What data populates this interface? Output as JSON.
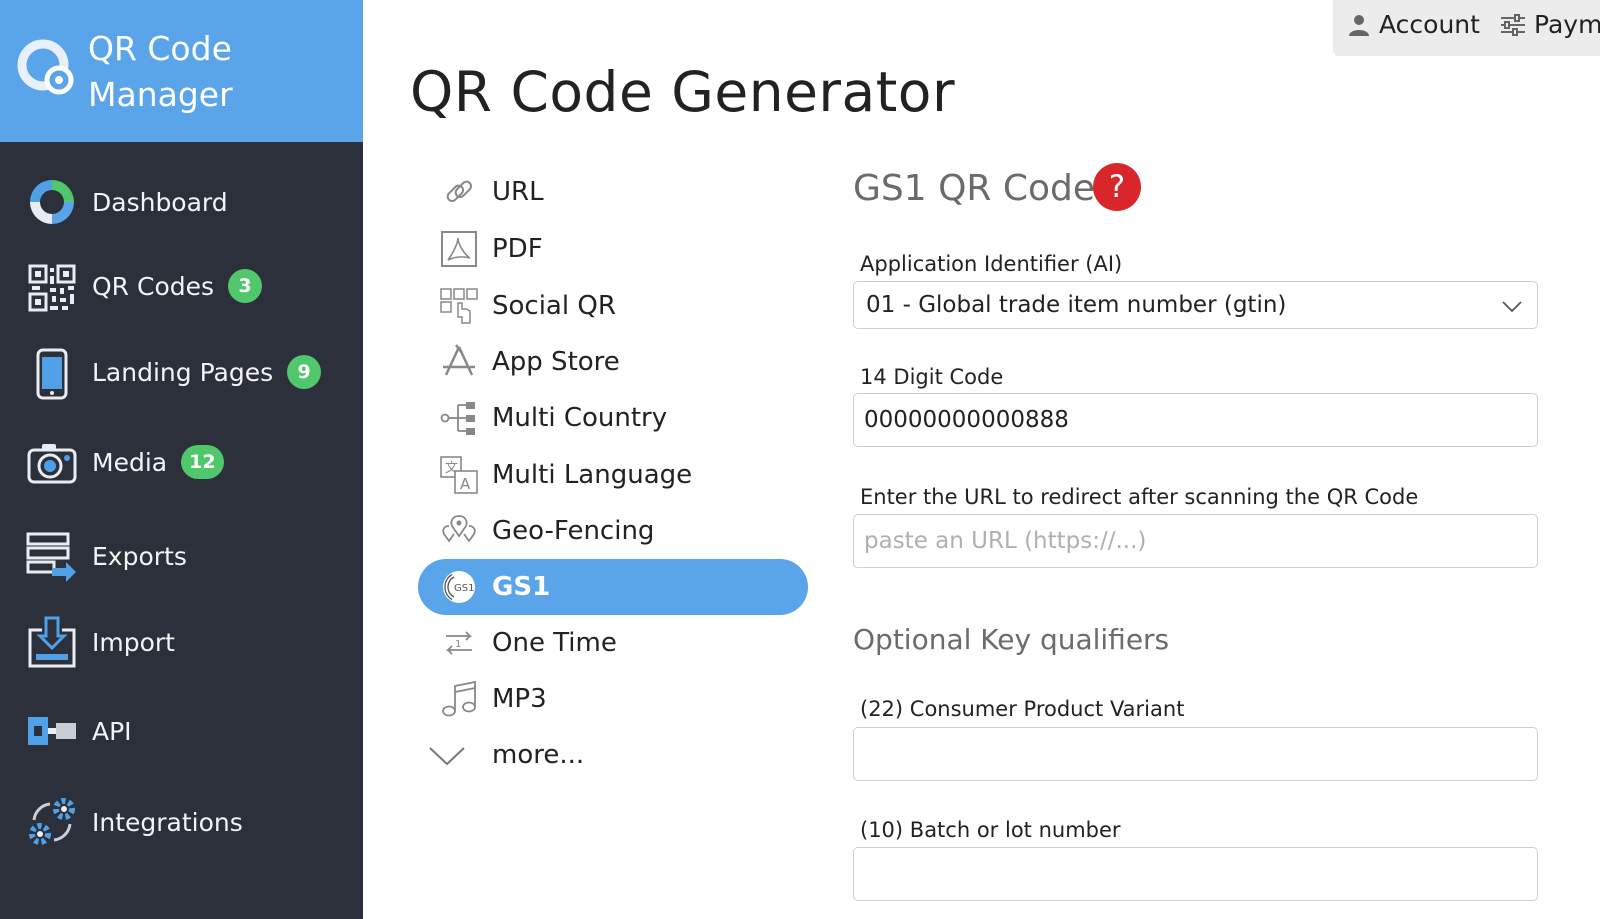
{
  "brand": {
    "title": "QR Code Manager"
  },
  "sidebar": {
    "items": [
      {
        "label": "Dashboard",
        "icon": "dashboard-donut-icon",
        "badge": ""
      },
      {
        "label": "QR Codes",
        "icon": "qr-code-icon",
        "badge": "3"
      },
      {
        "label": "Landing Pages",
        "icon": "mobile-phone-icon",
        "badge": "9"
      },
      {
        "label": "Media",
        "icon": "camera-icon",
        "badge": "12"
      },
      {
        "label": "Exports",
        "icon": "export-icon",
        "badge": ""
      },
      {
        "label": "Import",
        "icon": "import-icon",
        "badge": ""
      },
      {
        "label": "API",
        "icon": "api-icon",
        "badge": ""
      },
      {
        "label": "Integrations",
        "icon": "gears-icon",
        "badge": ""
      }
    ]
  },
  "topbar": {
    "account": "Account",
    "payments": "Payme"
  },
  "page": {
    "title": "QR Code Generator"
  },
  "types": {
    "items": [
      {
        "label": "URL",
        "icon": "link-icon"
      },
      {
        "label": "PDF",
        "icon": "pdf-icon"
      },
      {
        "label": "Social QR",
        "icon": "social-icon"
      },
      {
        "label": "App Store",
        "icon": "app-store-icon"
      },
      {
        "label": "Multi Country",
        "icon": "multi-country-icon"
      },
      {
        "label": "Multi Language",
        "icon": "translate-icon"
      },
      {
        "label": "Geo-Fencing",
        "icon": "geo-fencing-icon"
      },
      {
        "label": "GS1",
        "icon": "gs1-icon",
        "active": true
      },
      {
        "label": "One Time",
        "icon": "one-time-icon"
      },
      {
        "label": "MP3",
        "icon": "music-note-icon"
      },
      {
        "label": "more...",
        "icon": "chevron-down-icon"
      }
    ]
  },
  "form": {
    "title": "GS1 QR Code",
    "help": "?",
    "ai_label": "Application Identifier (AI)",
    "ai_value": "01 - Global trade item number (gtin)",
    "code_label": "14 Digit Code",
    "code_value": "00000000000888",
    "url_label": "Enter the URL to redirect after scanning the QR Code",
    "url_placeholder": "paste an URL (https://...)",
    "optional_title": "Optional Key qualifiers",
    "variant_label": "(22) Consumer Product Variant",
    "batch_label": "(10) Batch or lot number"
  },
  "colors": {
    "brand": "#5aa4ea",
    "sidebar": "#2b303a",
    "badge": "#4fc76a",
    "help": "#d8262b"
  }
}
